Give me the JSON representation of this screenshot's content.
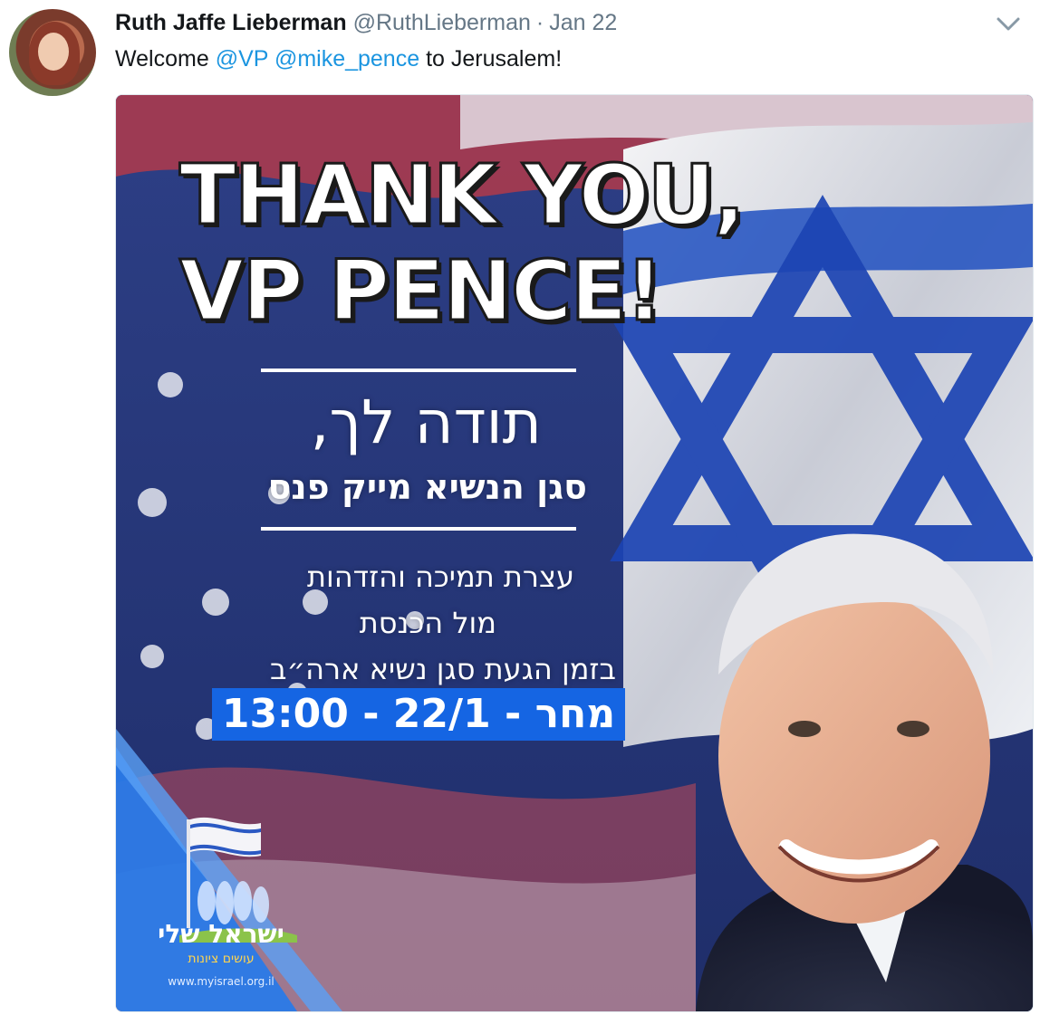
{
  "tweet": {
    "author_name": "Ruth Jaffe Lieberman",
    "handle": "@RuthLieberman",
    "separator": "·",
    "date": "Jan 22",
    "text_before": "Welcome",
    "mention_1": "@VP",
    "mention_2": "@mike_pence",
    "text_after": "to Jerusalem!"
  },
  "poster": {
    "title_line_1": "THANK YOU,",
    "title_line_2": "VP PENCE!",
    "hebrew_thanks": "תודה לך,",
    "hebrew_vp_name": "סגן הנשיא מייק פנס",
    "hebrew_rally_line_1": "עצרת תמיכה והזדהות",
    "hebrew_rally_line_2": "מול הכנסת",
    "hebrew_rally_line_3": "בזמן הגעת סגן נשיא ארה״ב",
    "date_time_banner": "13:00 - 22/1 - מחר",
    "logo_name": "ישראל שלי",
    "logo_tagline": "עושים ציונות",
    "logo_url": "www.myisrael.org.il"
  },
  "colors": {
    "mention_blue": "#1b95e0",
    "date_box_blue": "#1565e3",
    "muted_gray": "#657786"
  },
  "icons": {
    "menu": "chevron-down-icon"
  }
}
